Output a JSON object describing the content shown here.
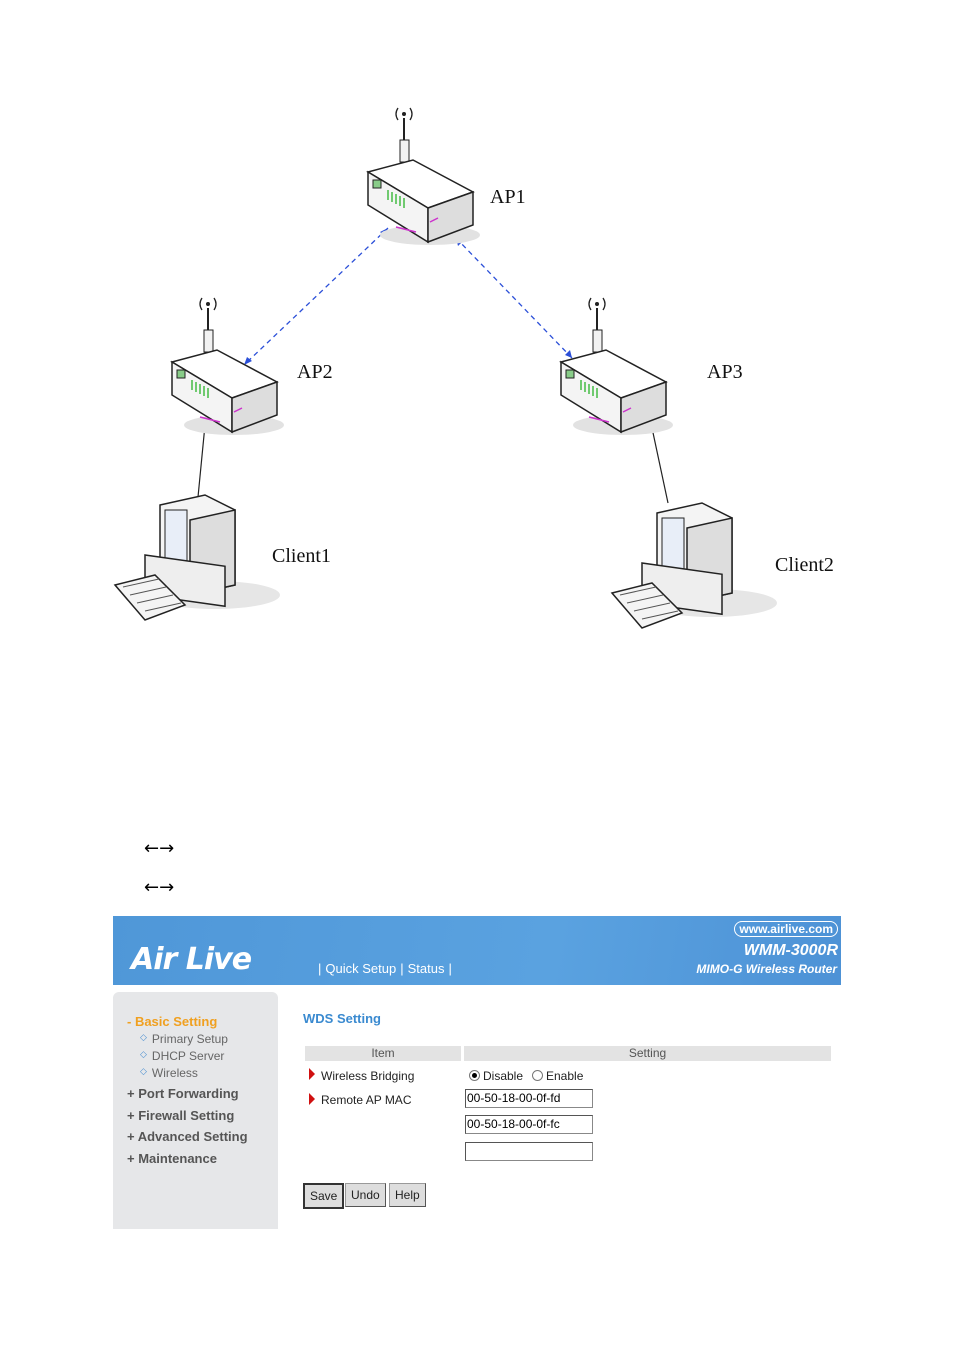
{
  "diagram": {
    "nodes": [
      {
        "id": "AP1",
        "label": "AP1",
        "type": "router-icon"
      },
      {
        "id": "AP2",
        "label": "AP2",
        "type": "router-icon"
      },
      {
        "id": "AP3",
        "label": "AP3",
        "type": "router-icon"
      },
      {
        "id": "Client1",
        "label": "Client1",
        "type": "computer-icon"
      },
      {
        "id": "Client2",
        "label": "Client2",
        "type": "computer-icon"
      }
    ],
    "links": [
      {
        "from": "AP1",
        "to": "AP2",
        "style": "dashed-wireless",
        "color": "#2b4fd8"
      },
      {
        "from": "AP1",
        "to": "AP3",
        "style": "dashed-wireless",
        "color": "#2b4fd8"
      },
      {
        "from": "AP2",
        "to": "Client1",
        "style": "wired"
      },
      {
        "from": "AP3",
        "to": "Client2",
        "style": "wired"
      }
    ]
  },
  "arrows": [
    "←→",
    "←→"
  ],
  "ui": {
    "logo": "Air Live",
    "nav": [
      "Quick Setup",
      "Status"
    ],
    "website": "www.airlive.com",
    "model": "WMM-3000R",
    "subtitle": "MIMO-G Wireless Router",
    "sidebar": {
      "basic": "- Basic Setting",
      "sub": [
        "Primary Setup",
        "DHCP Server",
        "Wireless"
      ],
      "main": [
        "+ Port Forwarding",
        "+ Firewall Setting",
        "+ Advanced Setting",
        "+ Maintenance"
      ]
    },
    "title": "WDS Setting",
    "table": {
      "col_item": "Item",
      "col_setting": "Setting"
    },
    "bridging_label": "Wireless Bridging",
    "bridging_options": [
      "Disable",
      "Enable"
    ],
    "bridging_selected": "Disable",
    "remote_label": "Remote AP MAC",
    "mac_values": [
      "00-50-18-00-0f-fd",
      "00-50-18-00-0f-fc",
      ""
    ],
    "buttons": [
      "Save",
      "Undo",
      "Help"
    ],
    "accent": "#3a8ad0",
    "active_color": "#f0a020"
  }
}
